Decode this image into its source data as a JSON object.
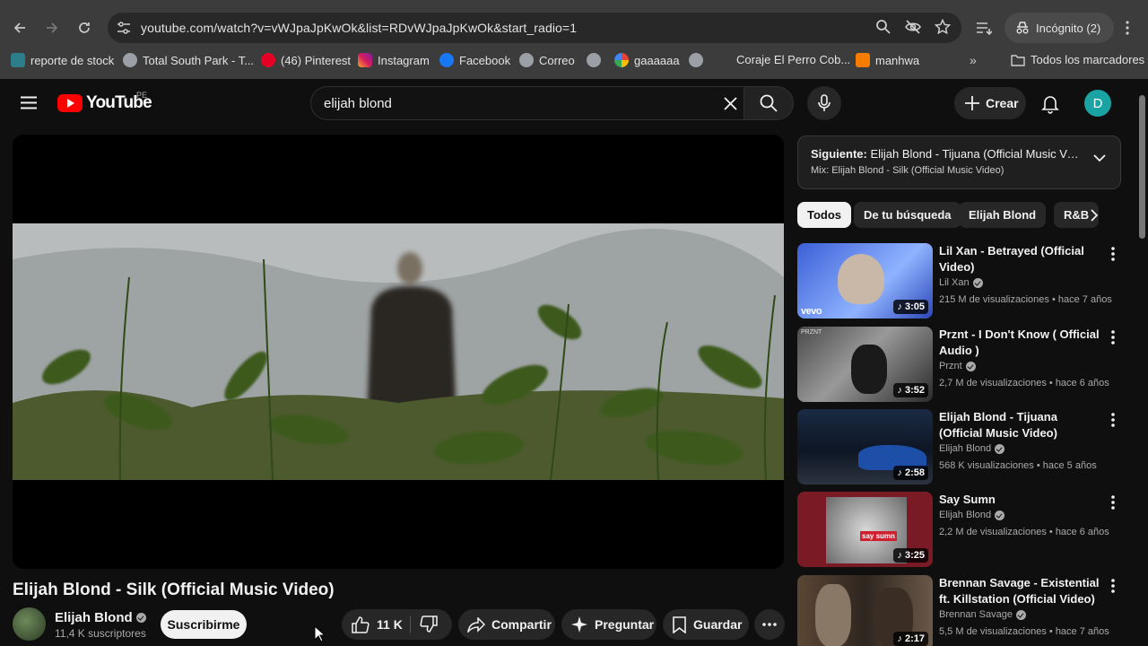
{
  "browser": {
    "url": "youtube.com/watch?v=vWJpaJpKwOk&list=RDvWJpaJpKwOk&start_radio=1",
    "incognito_label": "Incógnito (2)",
    "bookmarks": [
      {
        "label": "reporte de stock",
        "icon": "stock-icon"
      },
      {
        "label": "Total South Park - T...",
        "icon": "globe-icon"
      },
      {
        "label": "(46) Pinterest",
        "icon": "pinterest-icon"
      },
      {
        "label": "Instagram",
        "icon": "instagram-icon"
      },
      {
        "label": "Facebook",
        "icon": "facebook-icon"
      },
      {
        "label": "Correo",
        "icon": "globe-icon"
      },
      {
        "label": "gaaaaaa",
        "icon": "google-icon"
      },
      {
        "label": "",
        "icon": "globe-icon"
      },
      {
        "label": "Coraje El Perro Cob...",
        "icon": "blank-icon"
      },
      {
        "label": "manhwa",
        "icon": "manhwa-icon"
      }
    ],
    "all_bookmarks_label": "Todos los marcadores"
  },
  "header": {
    "logo_text": "YouTube",
    "country": "PE",
    "search_query": "elijah blond",
    "create_label": "Crear",
    "avatar_letter": "D"
  },
  "video": {
    "title": "Elijah Blond - Silk (Official Music Video)",
    "channel": "Elijah Blond",
    "subscribers": "11,4 K suscriptores",
    "subscribe_label": "Suscribirme",
    "likes": "11 K",
    "share_label": "Compartir",
    "ask_label": "Preguntar",
    "save_label": "Guardar"
  },
  "up_next": {
    "prefix": "Siguiente:",
    "title": "Elijah Blond - Tijuana (Official Music Video)",
    "mix": "Mix: Elijah Blond - Silk (Official Music Video)"
  },
  "chips": [
    "Todos",
    "De tu búsqueda",
    "Elijah Blond",
    "R&B"
  ],
  "recommendations": [
    {
      "title": "Lil Xan - Betrayed (Official Video)",
      "channel": "Lil Xan",
      "views": "215 M de visualizaciones",
      "age": "hace 7 años",
      "duration": "3:05",
      "badge": "vevo"
    },
    {
      "title": "Prznt - I Don't Know ( Official Audio )",
      "channel": "Prznt",
      "views": "2,7 M de visualizaciones",
      "age": "hace 6 años",
      "duration": "3:52",
      "badge": "PRZNT"
    },
    {
      "title": "Elijah Blond - Tijuana (Official Music Video)",
      "channel": "Elijah Blond",
      "views": "568 K visualizaciones",
      "age": "hace 5 años",
      "duration": "2:58",
      "badge": ""
    },
    {
      "title": "Say Sumn",
      "channel": "Elijah Blond",
      "views": "2,2 M de visualizaciones",
      "age": "hace 6 años",
      "duration": "3:25",
      "badge": "say sumn"
    },
    {
      "title": "Brennan Savage - Existential ft. Killstation (Official Video)",
      "channel": "Brennan Savage",
      "views": "5,5 M de visualizaciones",
      "age": "hace 7 años",
      "duration": "2:17",
      "badge": ""
    }
  ],
  "colors": {
    "accent_red": "#ff0000",
    "avatar_teal": "#1aa3a3",
    "background": "#0f0f0f"
  }
}
